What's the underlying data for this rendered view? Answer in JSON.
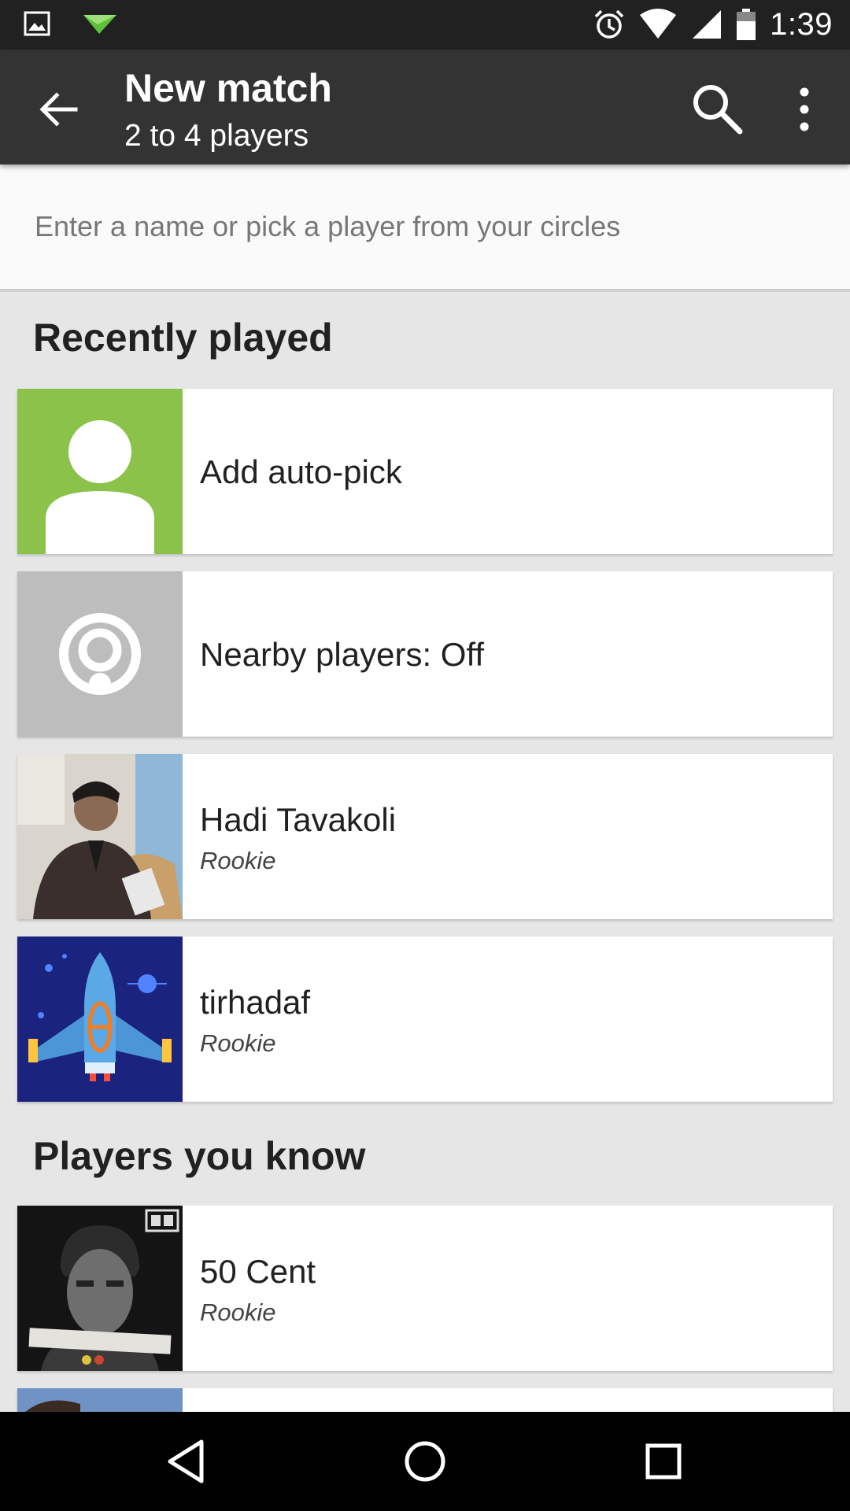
{
  "status_bar": {
    "time": "1:39",
    "left_icons": [
      "image-icon",
      "paper-plane-icon"
    ],
    "right_icons": [
      "alarm-icon",
      "wifi-icon",
      "signal-icon",
      "battery-icon"
    ]
  },
  "app_bar": {
    "title": "New match",
    "subtitle": "2 to 4 players",
    "icons": [
      "back-arrow-icon",
      "search-icon",
      "more-vert-icon"
    ]
  },
  "search": {
    "placeholder": "Enter a name or pick a player from your circles"
  },
  "sections": {
    "recently_played": "Recently played",
    "players_you_know": "Players you know"
  },
  "recent": [
    {
      "name": "Add auto-pick",
      "thumb": "auto-pick-person-icon",
      "color": "#8bc34a"
    },
    {
      "name": "Nearby players: Off",
      "thumb": "nearby-broadcast-icon",
      "color": "#bdbdbd"
    },
    {
      "name": "Hadi Tavakoli",
      "level": "Rookie",
      "thumb": "avatar-photo"
    },
    {
      "name": "tirhadaf",
      "level": "Rookie",
      "thumb": "spaceship-avatar",
      "color": "#1a237e"
    }
  ],
  "known": [
    {
      "name": "50 Cent",
      "level": "Rookie",
      "thumb": "album-cover-avatar"
    }
  ],
  "nav_bar": {
    "icons": [
      "back-triangle-icon",
      "home-circle-icon",
      "recents-square-icon"
    ]
  }
}
